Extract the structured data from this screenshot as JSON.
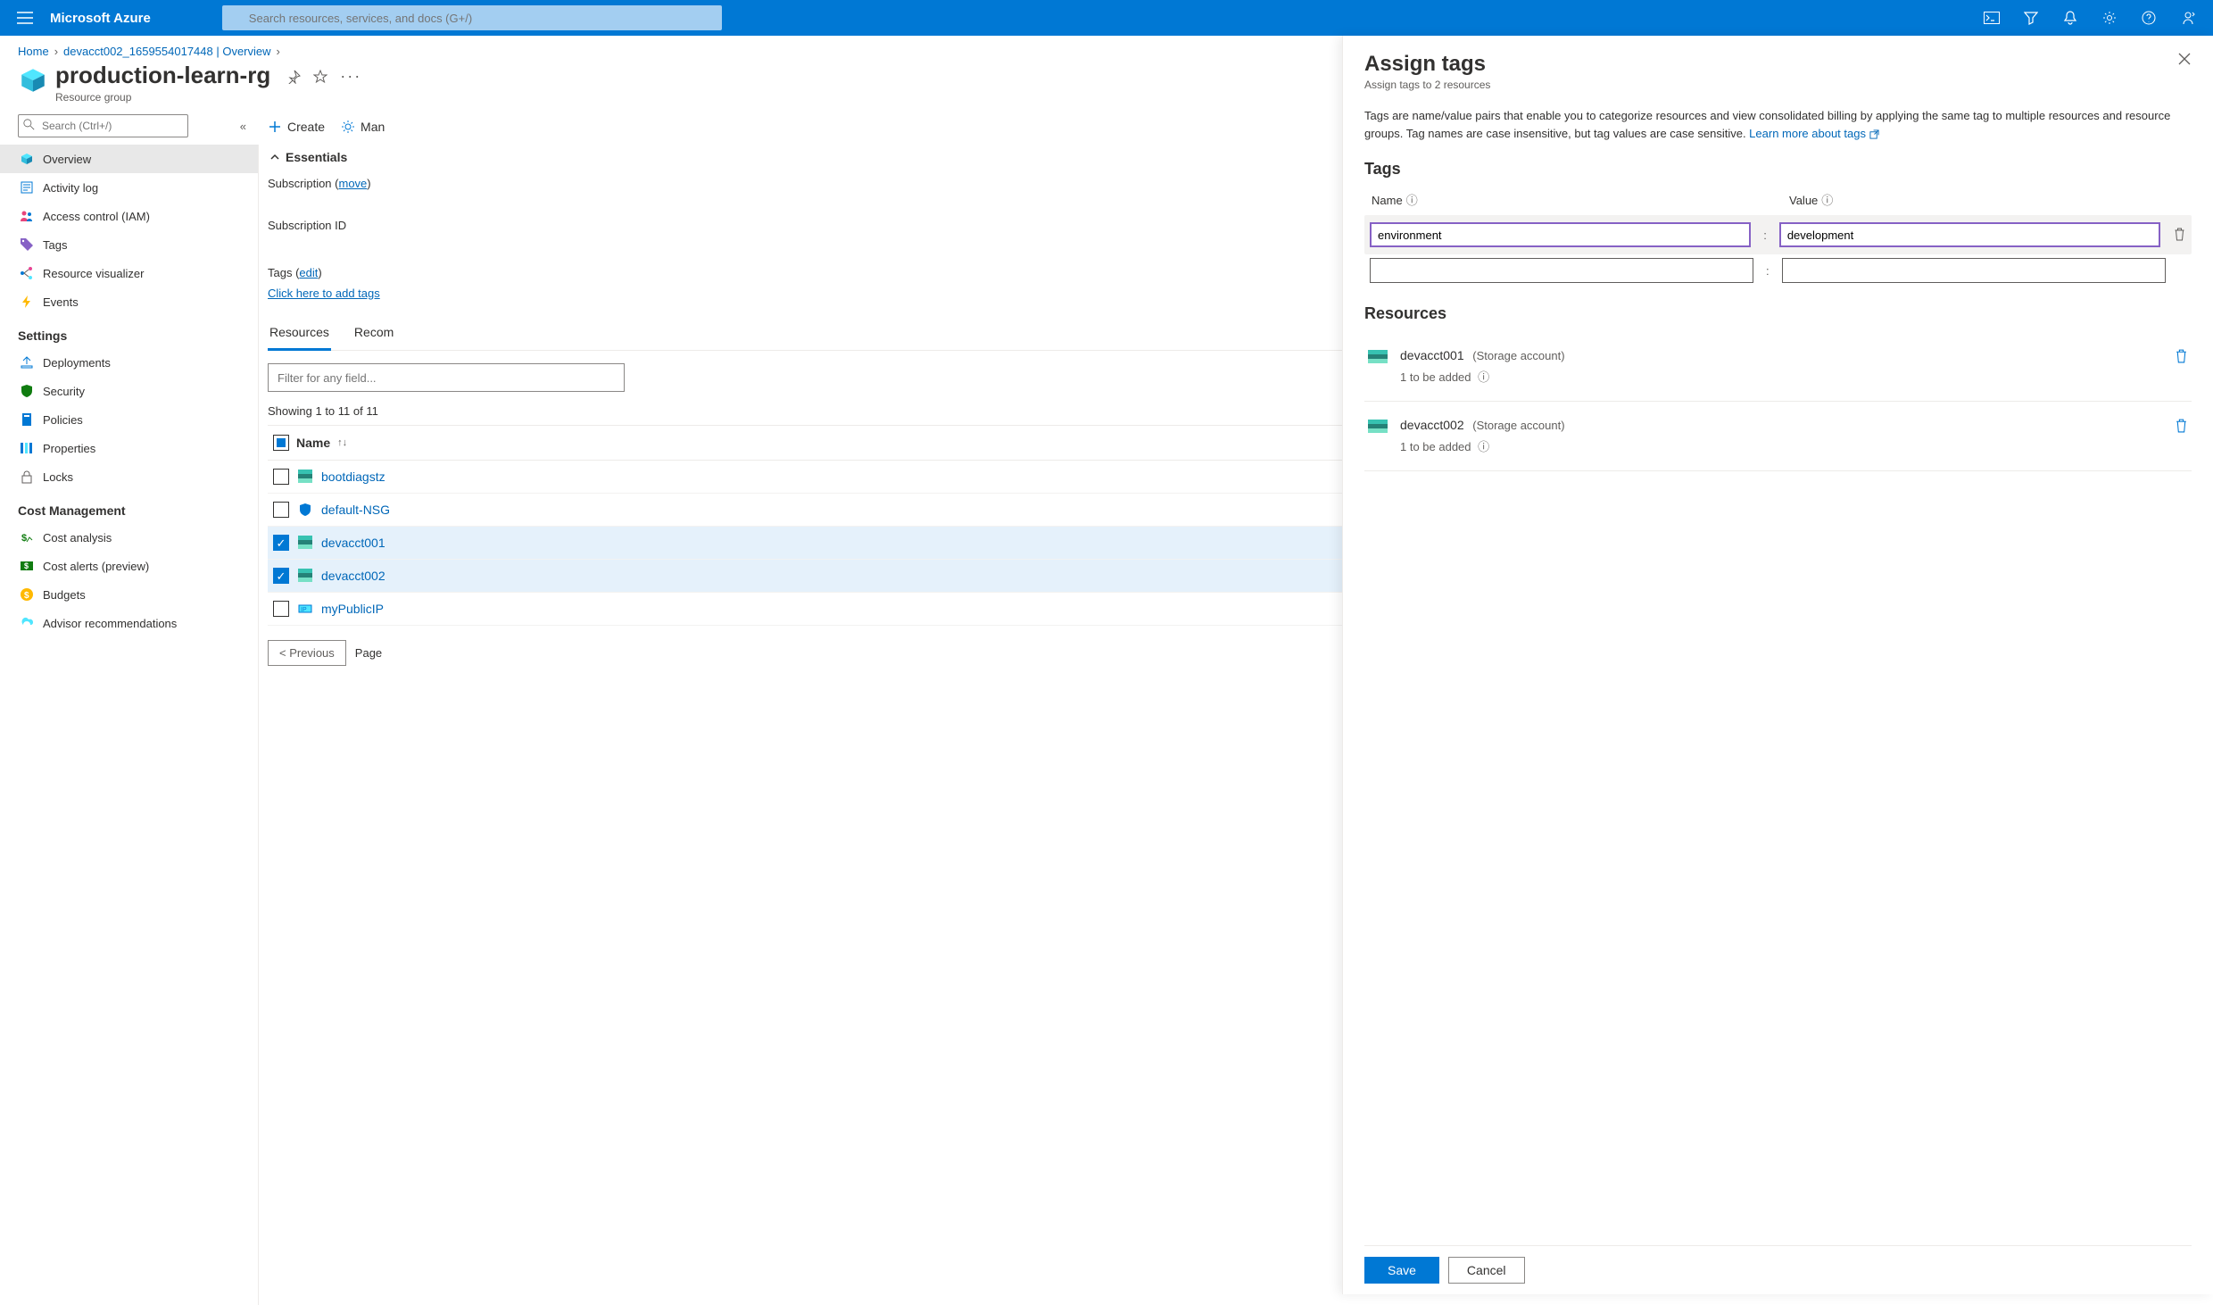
{
  "topbar": {
    "brand": "Microsoft Azure",
    "search_placeholder": "Search resources, services, and docs (G+/)"
  },
  "breadcrumb": {
    "home": "Home",
    "second": "devacct002_1659554017448 | Overview"
  },
  "page": {
    "title": "production-learn-rg",
    "subtitle": "Resource group"
  },
  "sidebar": {
    "search_placeholder": "Search (Ctrl+/)",
    "main": [
      {
        "label": "Overview",
        "icon": "cube"
      },
      {
        "label": "Activity log",
        "icon": "log"
      },
      {
        "label": "Access control (IAM)",
        "icon": "people"
      },
      {
        "label": "Tags",
        "icon": "tag"
      },
      {
        "label": "Resource visualizer",
        "icon": "viz"
      },
      {
        "label": "Events",
        "icon": "bolt"
      }
    ],
    "settings_heading": "Settings",
    "settings": [
      {
        "label": "Deployments",
        "icon": "deploy"
      },
      {
        "label": "Security",
        "icon": "shield"
      },
      {
        "label": "Policies",
        "icon": "policy"
      },
      {
        "label": "Properties",
        "icon": "props"
      },
      {
        "label": "Locks",
        "icon": "lock"
      }
    ],
    "cost_heading": "Cost Management",
    "cost": [
      {
        "label": "Cost analysis",
        "icon": "cost"
      },
      {
        "label": "Cost alerts (preview)",
        "icon": "alert"
      },
      {
        "label": "Budgets",
        "icon": "budget"
      },
      {
        "label": "Advisor recommendations",
        "icon": "advisor"
      }
    ]
  },
  "content": {
    "cmd_create": "Create",
    "cmd_manage": "Man",
    "essentials": "Essentials",
    "subscription_label": "Subscription (",
    "subscription_move": "move",
    "subscription_close": ")",
    "subscription_id_label": "Subscription ID",
    "tags_label": "Tags (",
    "tags_edit": "edit",
    "tags_close": ")",
    "tags_add_link": "Click here to add tags",
    "tab_resources": "Resources",
    "tab_recom": "Recom",
    "filter_placeholder": "Filter for any field...",
    "showing": "Showing 1 to 11 of 11",
    "col_name": "Name",
    "rows": [
      {
        "name": "bootdiagstz",
        "checked": false,
        "icon": "storage"
      },
      {
        "name": "default-NSG",
        "checked": false,
        "icon": "shield2"
      },
      {
        "name": "devacct001",
        "checked": true,
        "icon": "storage"
      },
      {
        "name": "devacct002",
        "checked": true,
        "icon": "storage"
      },
      {
        "name": "myPublicIP",
        "checked": false,
        "icon": "ip"
      }
    ],
    "prev": "< Previous",
    "page_lbl": "Page"
  },
  "panel": {
    "title": "Assign tags",
    "subtitle": "Assign tags to 2 resources",
    "desc_a": "Tags are name/value pairs that enable you to categorize resources and view consolidated billing by applying the same tag to multiple resources and resource groups. Tag names are case insensitive, but tag values are case sensitive. ",
    "learn_link": "Learn more about tags",
    "tags_h": "Tags",
    "col_name": "Name",
    "col_value": "Value",
    "tag1_name": "environment",
    "tag1_value": "development",
    "resources_h": "Resources",
    "res": [
      {
        "name": "devacct001",
        "type": "(Storage account)",
        "sub": "1 to be added"
      },
      {
        "name": "devacct002",
        "type": "(Storage account)",
        "sub": "1 to be added"
      }
    ],
    "save": "Save",
    "cancel": "Cancel"
  }
}
